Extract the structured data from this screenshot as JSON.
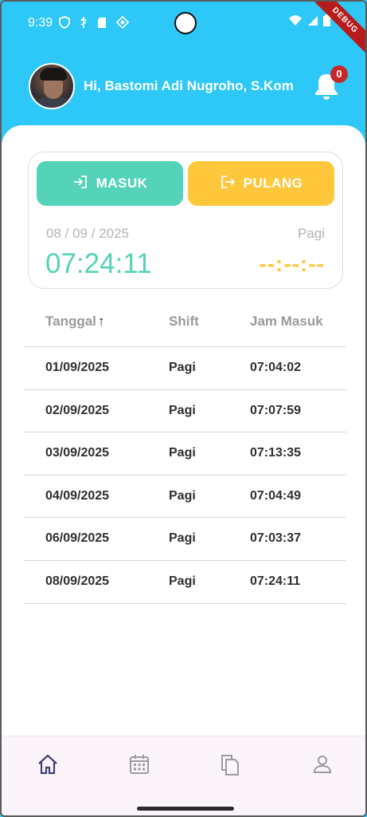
{
  "status_bar": {
    "time": "9:39",
    "debug_label": "DEBUG"
  },
  "header": {
    "greeting": "Hi, Bastomi Adi Nugroho, S.Kom",
    "notification_count": "0"
  },
  "attendance_card": {
    "masuk_label": "MASUK",
    "pulang_label": "PULANG",
    "date": "08 / 09 / 2025",
    "shift": "Pagi",
    "time_in": "07:24:11",
    "time_out": "--:--:--"
  },
  "table": {
    "headers": {
      "date": "Tanggal",
      "sort_indicator": "↑",
      "shift": "Shift",
      "jam_masuk": "Jam Masuk"
    },
    "rows": [
      {
        "date": "01/09/2025",
        "shift": "Pagi",
        "jam_masuk": "07:04:02"
      },
      {
        "date": "02/09/2025",
        "shift": "Pagi",
        "jam_masuk": "07:07:59"
      },
      {
        "date": "03/09/2025",
        "shift": "Pagi",
        "jam_masuk": "07:13:35"
      },
      {
        "date": "04/09/2025",
        "shift": "Pagi",
        "jam_masuk": "07:04:49"
      },
      {
        "date": "06/09/2025",
        "shift": "Pagi",
        "jam_masuk": "07:03:37"
      },
      {
        "date": "08/09/2025",
        "shift": "Pagi",
        "jam_masuk": "07:24:11"
      }
    ]
  },
  "bottom_nav": {
    "items": [
      {
        "icon": "home-icon",
        "active": true
      },
      {
        "icon": "calendar-icon",
        "active": false
      },
      {
        "icon": "copy-icon",
        "active": false
      },
      {
        "icon": "profile-icon",
        "active": false
      }
    ]
  },
  "colors": {
    "header_bg": "#2ec8f8",
    "masuk": "#55d3b9",
    "pulang": "#ffc83c",
    "badge": "#c62828"
  }
}
